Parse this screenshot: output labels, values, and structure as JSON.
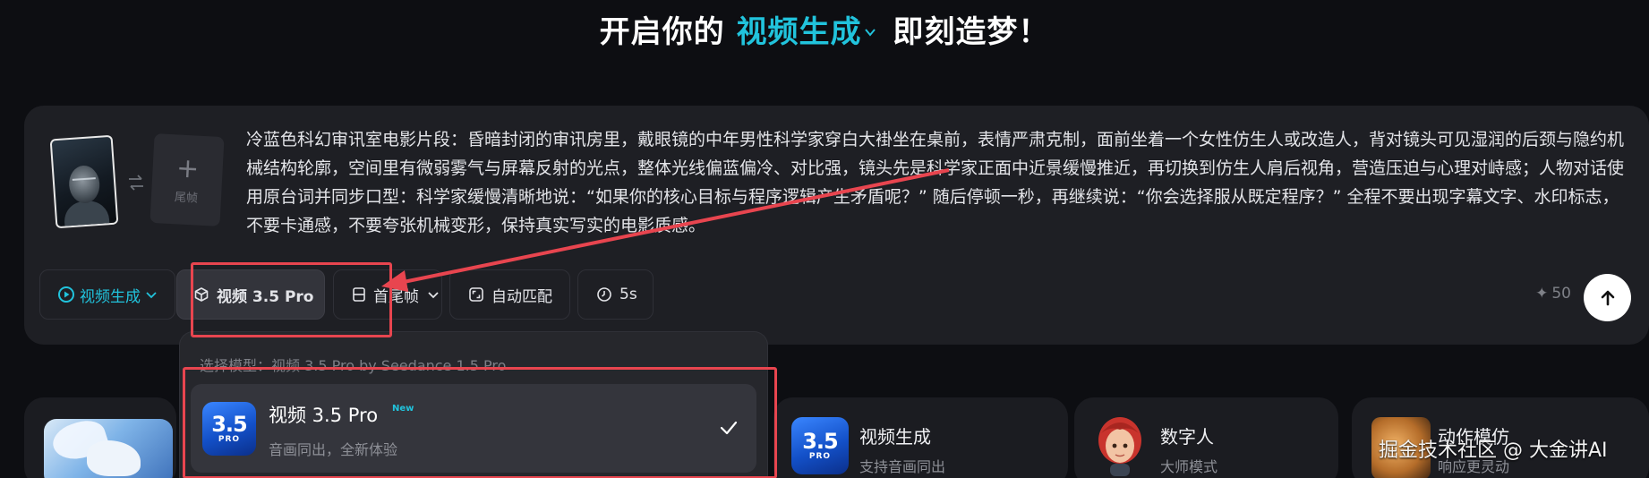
{
  "header": {
    "prefix": "开启你的",
    "mode": "视频生成",
    "suffix": "即刻造梦！"
  },
  "prompt": {
    "last_frame_label": "尾帧",
    "text": "冷蓝色科幻审讯室电影片段：昏暗封闭的审讯房里，戴眼镜的中年男性科学家穿白大褂坐在桌前，表情严肃克制，面前坐着一个女性仿生人或改造人，背对镜头可见湿润的后颈与隐约机械结构轮廓，空间里有微弱雾气与屏幕反射的光点，整体光线偏蓝偏冷、对比强，镜头先是科学家正面中近景缓慢推近，再切换到仿生人肩后视角，营造压迫与心理对峙感；人物对话使用原台词并同步口型：科学家缓慢清晰地说：“如果你的核心目标与程序逻辑产生矛盾呢？” 随后停顿一秒，再继续说：“你会选择服从既定程序？” 全程不要出现字幕文字、水印标志，不要卡通感，不要夸张机械变形，保持真实写实的电影质感。"
  },
  "toolbar": {
    "mode_label": "视频生成",
    "model_label": "视频 3.5 Pro",
    "frame_label": "首尾帧",
    "auto_label": "自动匹配",
    "duration_label": "5s",
    "credits": "50"
  },
  "dropdown": {
    "caption": "选择模型：视频 3.5 Pro by Seedance 1.5 Pro",
    "item": {
      "name": "视频 3.5 Pro",
      "badge": "New",
      "desc": "音画同出，全新体验",
      "logo_number": "3.5",
      "logo_text": "PRO"
    }
  },
  "features": [
    {
      "title": "视频生成",
      "sub": "支持音画同出",
      "logo_number": "3.5",
      "logo_text": "PRO"
    },
    {
      "title": "数字人",
      "sub": "大师模式"
    },
    {
      "title": "动作模仿",
      "sub": "响应更灵动"
    }
  ],
  "watermark": "掘金技术社区 @ 大金讲AI",
  "colors": {
    "accent": "#21c3dc",
    "highlight": "#e8454f",
    "background": "#0d0e12",
    "card": "#1e1f24"
  }
}
